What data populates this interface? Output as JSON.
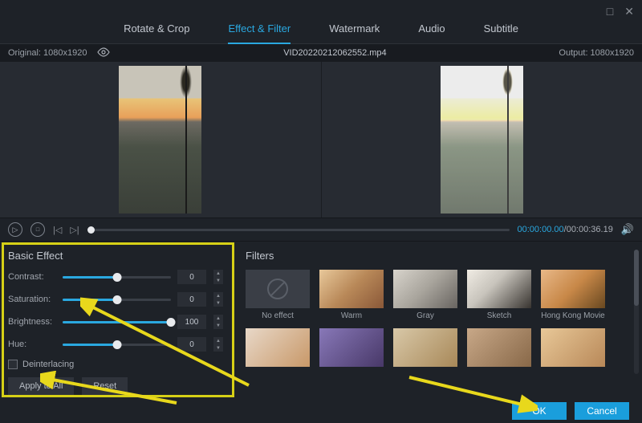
{
  "window": {
    "maximize": "□",
    "close": "✕"
  },
  "tabs": {
    "rotate": "Rotate & Crop",
    "effect": "Effect & Filter",
    "watermark": "Watermark",
    "audio": "Audio",
    "subtitle": "Subtitle"
  },
  "info": {
    "original": "Original: 1080x1920",
    "filename": "VID20220212062552.mp4",
    "output": "Output: 1080x1920"
  },
  "time": {
    "current": "00:00:00.00",
    "total": "/00:00:36.19"
  },
  "basic": {
    "title": "Basic Effect",
    "contrast_label": "Contrast:",
    "contrast_val": "0",
    "saturation_label": "Saturation:",
    "saturation_val": "0",
    "brightness_label": "Brightness:",
    "brightness_val": "100",
    "hue_label": "Hue:",
    "hue_val": "0",
    "deinterlace": "Deinterlacing",
    "apply_all": "Apply to All",
    "reset": "Reset"
  },
  "filters": {
    "title": "Filters",
    "noeffect": "No effect",
    "warm": "Warm",
    "gray": "Gray",
    "sketch": "Sketch",
    "hk": "Hong Kong Movie"
  },
  "footer": {
    "ok": "OK",
    "cancel": "Cancel"
  }
}
